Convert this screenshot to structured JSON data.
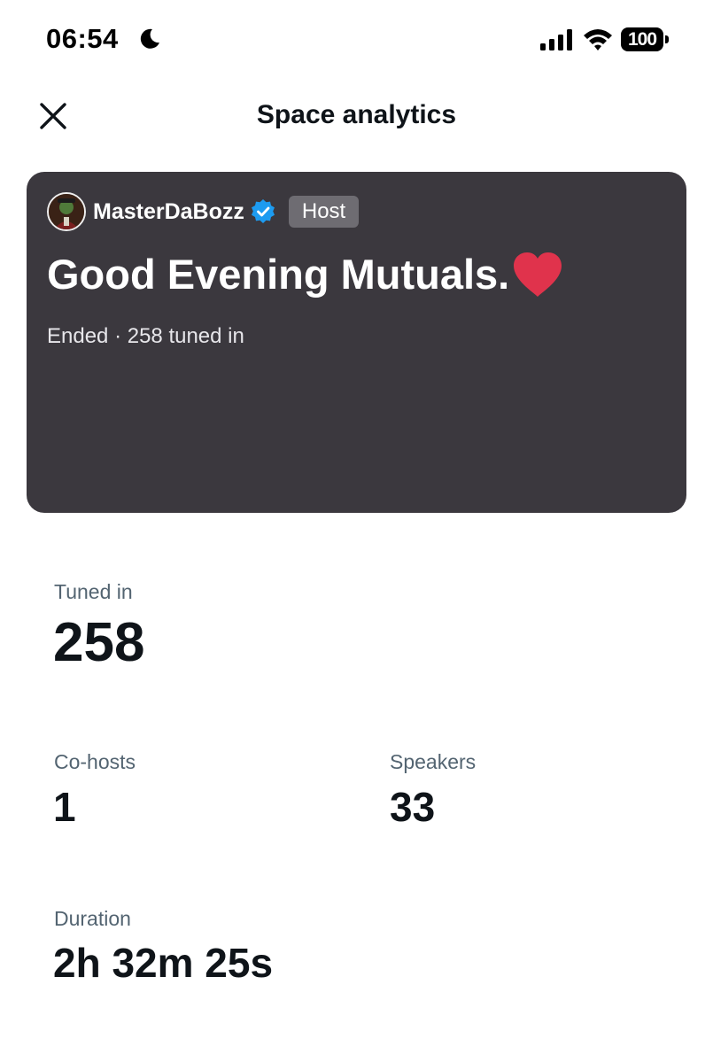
{
  "status_bar": {
    "time": "06:54",
    "battery_level": "100",
    "icons": [
      "moon-icon",
      "signal-icon",
      "wifi-icon",
      "battery-icon"
    ]
  },
  "header": {
    "title": "Space analytics",
    "close_icon": "close-icon"
  },
  "space_card": {
    "host_name": "MasterDaBozz",
    "host_badge": "Host",
    "verified": true,
    "title": "Good Evening Mutuals.",
    "title_emoji": "heart-icon",
    "status_text": "Ended · 258 tuned in",
    "background_color": "#3b383e",
    "heart_color": "#e0334c",
    "verified_color": "#1d9bf0"
  },
  "stats": {
    "tuned_in": {
      "label": "Tuned in",
      "value": "258"
    },
    "co_hosts": {
      "label": "Co-hosts",
      "value": "1"
    },
    "speakers": {
      "label": "Speakers",
      "value": "33"
    },
    "duration": {
      "label": "Duration",
      "value": "2h 32m 25s"
    }
  }
}
